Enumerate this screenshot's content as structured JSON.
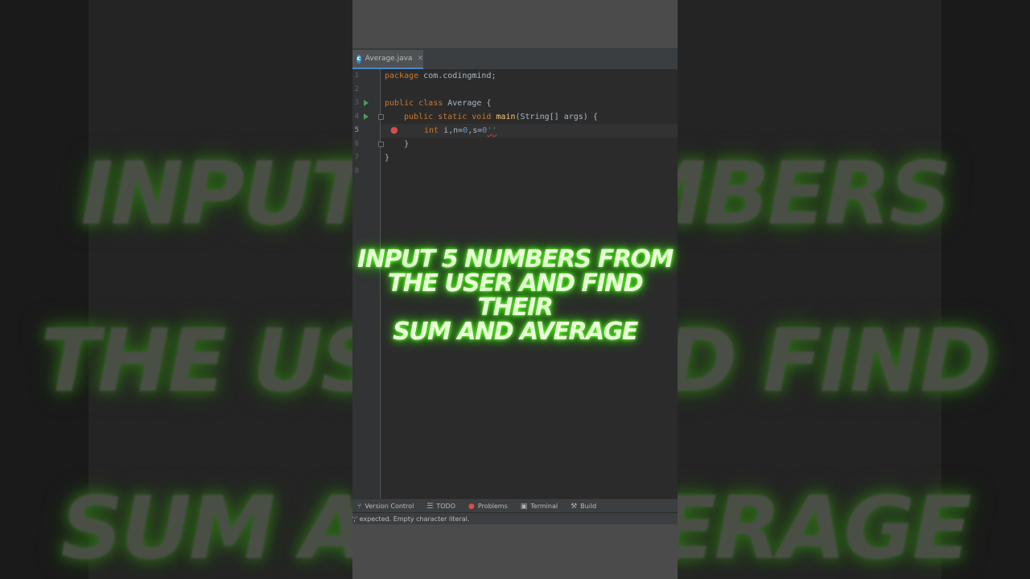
{
  "caption": {
    "line1": "INPUT 5 NUMBERS FROM",
    "line2": "THE USER AND FIND THEIR",
    "line3": "SUM AND AVERAGE"
  },
  "editor": {
    "tab_label": "Average.java",
    "tab_icon": "java-class-icon",
    "lines": [
      {
        "num": "1"
      },
      {
        "num": "2"
      },
      {
        "num": "3"
      },
      {
        "num": "4"
      },
      {
        "num": "5"
      },
      {
        "num": "6"
      },
      {
        "num": "7"
      },
      {
        "num": "8"
      }
    ],
    "code": {
      "l1_kw": "package",
      "l1_rest": " com.codingmind;",
      "l3_kw": "public class",
      "l3_rest": " Average {",
      "l4_kw": "public static void",
      "l4_fn": "main",
      "l4_rest": "(String[] args) {",
      "l5_kw": "int",
      "l5_rest": " i,n=",
      "l5_n1": "0",
      "l5_mid": ",s=",
      "l5_n2": "0",
      "l5_err": "''",
      "l6": "    }",
      "l7": "}"
    }
  },
  "toolbar": {
    "version_control": "Version Control",
    "todo": "TODO",
    "problems": "Problems",
    "terminal": "Terminal",
    "build": "Build"
  },
  "status": {
    "message": "';' expected. Empty character literal."
  },
  "colors": {
    "caption_glow": "#3dde12",
    "keyword": "#cc7832",
    "function": "#ffc66d",
    "number": "#6897bb",
    "tab_underline": "#4a88c7"
  }
}
